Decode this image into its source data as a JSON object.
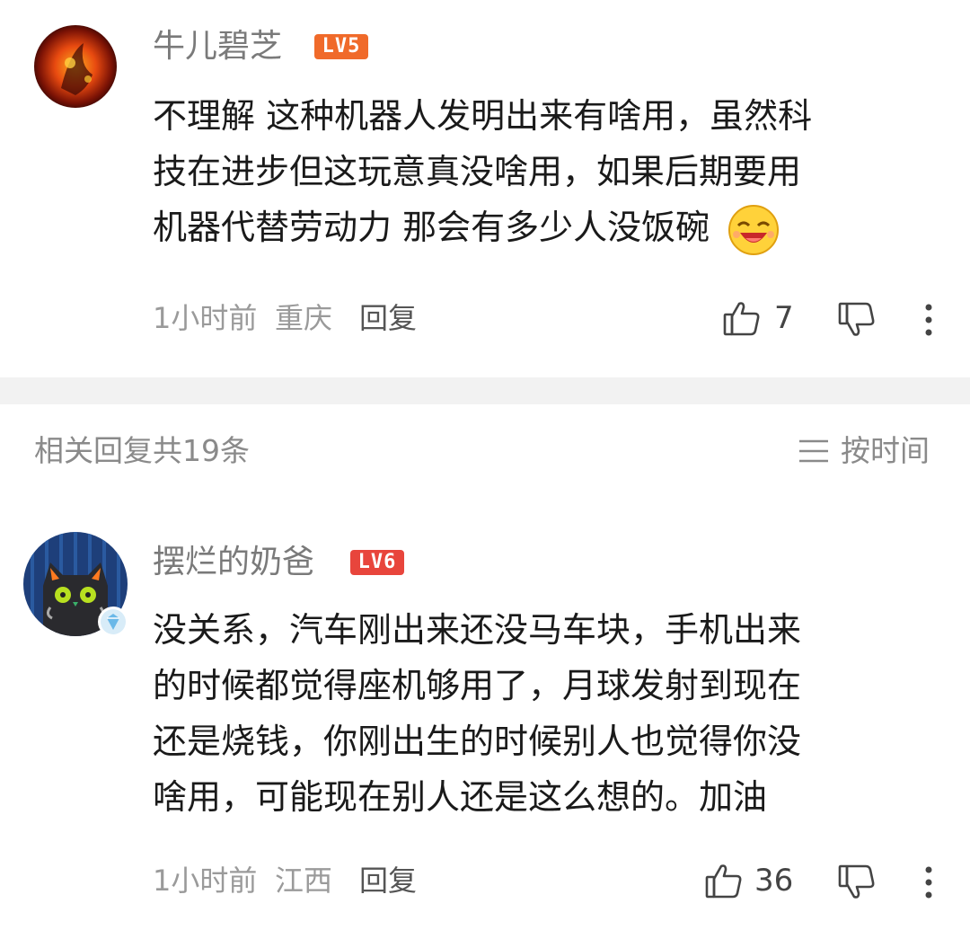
{
  "comment1": {
    "username": "牛儿碧芝",
    "level": "LV5",
    "level_color": "#f06a2a",
    "lines": [
      "不理解 这种机器人发明出来有啥用，虽然科",
      "技在进步但这玩意真没啥用，如果后期要用",
      "机器代替劳动力 那会有多少人没饭碗"
    ],
    "time": "1小时前",
    "location": "重庆",
    "reply_label": "回复",
    "likes": "7"
  },
  "replies_header": {
    "title": "相关回复共19条",
    "sort_label": "按时间"
  },
  "comment2": {
    "username": "摆烂的奶爸",
    "level": "LV6",
    "level_color": "#e8453c",
    "lines": [
      "没关系，汽车刚出来还没马车块，手机出来",
      "的时候都觉得座机够用了，月球发射到现在",
      "还是烧钱，你刚出生的时候别人也觉得你没",
      "啥用，可能现在别人还是这么想的。加油"
    ],
    "time": "1小时前",
    "location": "江西",
    "reply_label": "回复",
    "likes": "36"
  },
  "icons": [
    "fire-avatar",
    "cat-avatar",
    "verified-badge-icon",
    "laughing-emoji-icon",
    "thumbs-up-icon",
    "thumbs-down-icon",
    "more-icon",
    "sort-lines-icon"
  ]
}
